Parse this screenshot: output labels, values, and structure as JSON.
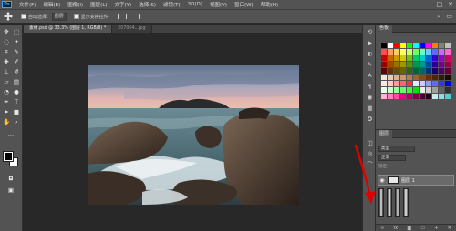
{
  "menubar": {
    "logo": "Ps",
    "items": [
      "文件(F)",
      "编辑(E)",
      "图像(I)",
      "图层(L)",
      "文字(Y)",
      "选择(S)",
      "滤镜(T)",
      "3D(D)",
      "视图(V)",
      "窗口(W)",
      "帮助(H)"
    ],
    "controls": [
      "—",
      "□",
      "✕"
    ]
  },
  "optionsbar": {
    "auto_select_label": "自动选择:",
    "auto_select_value": "图层",
    "transform_label": "显示变换控件"
  },
  "tabs": [
    {
      "label": "素材.psd @ 33.3% (图层 1, RGB/8) *",
      "active": true
    },
    {
      "label": "207064...jpg",
      "active": false
    }
  ],
  "toolbar": {
    "tools": [
      "move-tool",
      "marquee-tool",
      "lasso-tool",
      "magic-wand-tool",
      "crop-tool",
      "eyedropper-tool",
      "healing-tool",
      "brush-tool",
      "stamp-tool",
      "history-brush-tool",
      "eraser-tool",
      "gradient-tool",
      "blur-tool",
      "dodge-tool",
      "pen-tool",
      "type-tool",
      "path-select-tool",
      "shape-tool",
      "hand-tool",
      "zoom-tool"
    ],
    "fg_color": "#000000",
    "bg_color": "#ffffff"
  },
  "panels": {
    "swatches_tab": "色板",
    "layers_tab": "图层",
    "layer_filter": "类型",
    "layer_blend": "正常",
    "layer_lock": "锁定:",
    "layer_name": "图层 1",
    "swatches": [
      "#000000",
      "#ffffff",
      "#ff0000",
      "#ffff00",
      "#00ff00",
      "#00ffff",
      "#0000ff",
      "#ff00ff",
      "#ff8000",
      "#808080",
      "#c0c0c0",
      "#ff4d4d",
      "#ff9966",
      "#ffcc66",
      "#ffff66",
      "#ccff66",
      "#66ff66",
      "#66ffcc",
      "#66ccff",
      "#6666ff",
      "#cc66ff",
      "#ff66cc",
      "#cc0000",
      "#cc6600",
      "#cc9900",
      "#cccc00",
      "#66cc00",
      "#00cc66",
      "#00cccc",
      "#0066cc",
      "#3300cc",
      "#9900cc",
      "#cc0066",
      "#990000",
      "#994c00",
      "#997300",
      "#999900",
      "#4c9900",
      "#00994c",
      "#009999",
      "#004c99",
      "#260099",
      "#730099",
      "#99004c",
      "#660000",
      "#663300",
      "#664d00",
      "#666600",
      "#336600",
      "#006633",
      "#006666",
      "#003366",
      "#1a0066",
      "#4d0066",
      "#660033",
      "#f2e6d9",
      "#e6ccb3",
      "#d9b38c",
      "#cc9966",
      "#b37f4d",
      "#996633",
      "#7f4d1a",
      "#663300",
      "#4d2600",
      "#331a00",
      "#1a0d00",
      "#ffe6e6",
      "#ffcccc",
      "#ff9999",
      "#ff6666",
      "#ff3333",
      "#e6e6ff",
      "#ccccff",
      "#9999ff",
      "#6666ff",
      "#3333ff",
      "#0000e6",
      "#e6ffe6",
      "#ccffcc",
      "#99ff99",
      "#66ff66",
      "#33ff33",
      "#00e600",
      "#f0f0f0",
      "#d0d0d0",
      "#a0a0a0",
      "#606060",
      "#303030",
      "#ffb3d9",
      "#ff80bf",
      "#ff4da6",
      "#e6008a",
      "#b3006b",
      "#80004d",
      "#4d002e",
      "#260017",
      "#c2f0f0",
      "#85e0e0",
      "#47d1d1"
    ],
    "panel_icons": [
      "history-icon",
      "properties-icon",
      "adjustments-icon",
      "brush-settings-icon",
      "character-icon",
      "paragraph-icon",
      "color-icon",
      "swatches-icon",
      "styles-icon",
      "layers-icon",
      "channels-icon",
      "paths-icon"
    ]
  }
}
